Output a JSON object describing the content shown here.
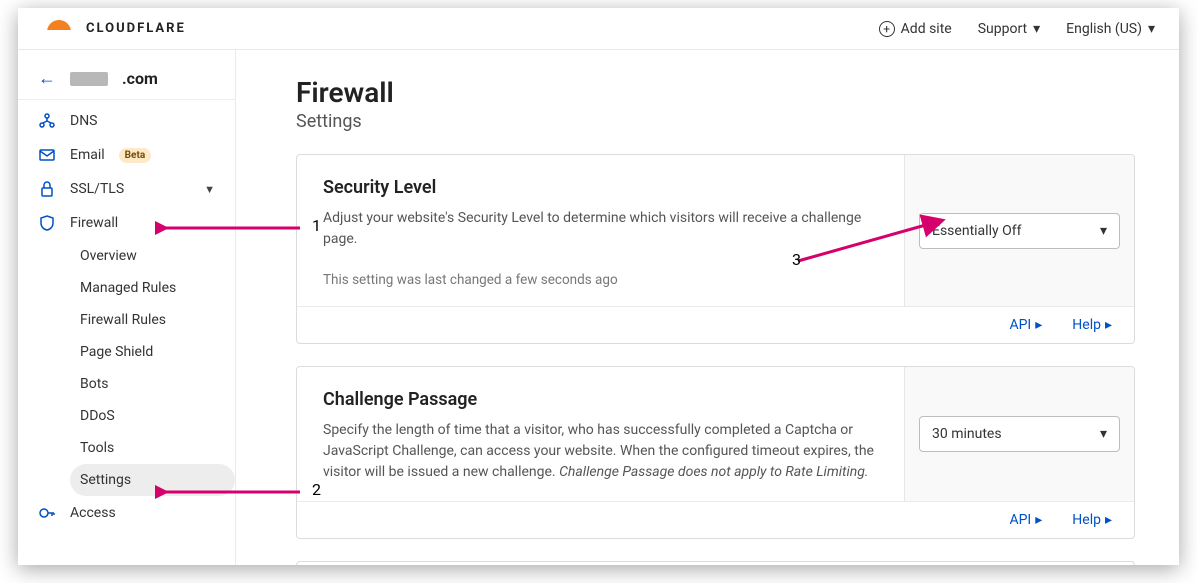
{
  "header": {
    "brand": "CLOUDFLARE",
    "add_site": "Add site",
    "support": "Support",
    "language": "English (US)"
  },
  "sidebar": {
    "domain_suffix": ".com",
    "items": {
      "dns": "DNS",
      "email": "Email",
      "email_badge": "Beta",
      "ssl": "SSL/TLS",
      "firewall": "Firewall",
      "access": "Access"
    },
    "firewall_sub": {
      "overview": "Overview",
      "managed": "Managed Rules",
      "rules": "Firewall Rules",
      "pageshield": "Page Shield",
      "bots": "Bots",
      "ddos": "DDoS",
      "tools": "Tools",
      "settings": "Settings"
    }
  },
  "page": {
    "title": "Firewall",
    "subtitle": "Settings"
  },
  "cards": {
    "security": {
      "title": "Security Level",
      "desc": "Adjust your website's Security Level to determine which visitors will receive a challenge page.",
      "meta": "This setting was last changed a few seconds ago",
      "value": "Essentially Off"
    },
    "challenge": {
      "title": "Challenge Passage",
      "desc_a": "Specify the length of time that a visitor, who has successfully completed a Captcha or JavaScript Challenge, can access your website. When the configured timeout expires, the visitor will be issued a new challenge. ",
      "desc_b": "Challenge Passage does not apply to Rate Limiting.",
      "value": "30 minutes"
    },
    "footer": {
      "api": "API",
      "help": "Help"
    }
  },
  "annotations": {
    "n1": "1",
    "n2": "2",
    "n3": "3"
  }
}
